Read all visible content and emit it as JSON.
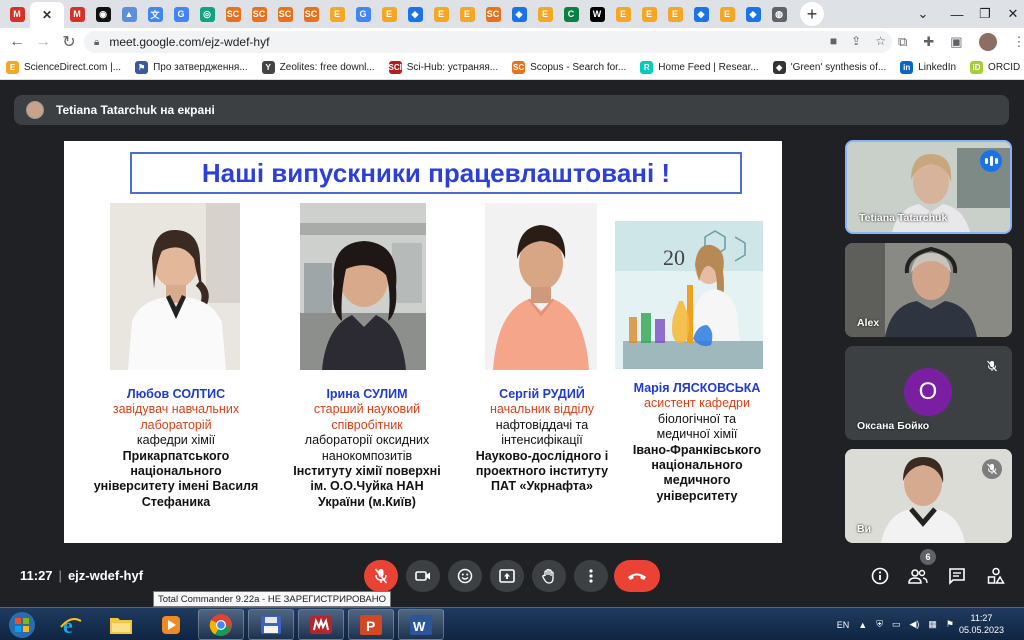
{
  "browser": {
    "tabs": [
      {
        "icon": "gmail-icon",
        "letter": "M",
        "color": "#d93025"
      },
      {
        "icon": "close-icon",
        "letter": "✕",
        "color": "#333",
        "active": true
      },
      {
        "icon": "gmail-icon",
        "letter": "M",
        "color": "#d93025"
      },
      {
        "icon": "eye-icon",
        "letter": "◉",
        "color": "#111"
      },
      {
        "icon": "chart-icon",
        "letter": "▲",
        "color": "#5b8fd8"
      },
      {
        "icon": "translate-icon",
        "letter": "文",
        "color": "#4285f4"
      },
      {
        "icon": "google-icon",
        "letter": "G",
        "color": "#4285f4"
      },
      {
        "icon": "openai-icon",
        "letter": "◎",
        "color": "#10a37f"
      },
      {
        "icon": "scopus-icon",
        "letter": "SC",
        "color": "#e9711c"
      },
      {
        "icon": "scopus-icon",
        "letter": "SC",
        "color": "#e9711c"
      },
      {
        "icon": "scopus-icon",
        "letter": "SC",
        "color": "#e9711c"
      },
      {
        "icon": "scopus-icon",
        "letter": "SC",
        "color": "#e9711c"
      },
      {
        "icon": "elsevier-icon",
        "letter": "E",
        "color": "#f5a623"
      },
      {
        "icon": "google-icon",
        "letter": "G",
        "color": "#4285f4"
      },
      {
        "icon": "elsevier-icon",
        "letter": "E",
        "color": "#f5a623"
      },
      {
        "icon": "diamond-icon",
        "letter": "◆",
        "color": "#1a73e8"
      },
      {
        "icon": "elsevier-icon",
        "letter": "E",
        "color": "#f5a623"
      },
      {
        "icon": "elsevier-icon",
        "letter": "E",
        "color": "#f5a623"
      },
      {
        "icon": "scopus-icon",
        "letter": "SC",
        "color": "#e9711c"
      },
      {
        "icon": "diamond-icon",
        "letter": "◆",
        "color": "#1a73e8"
      },
      {
        "icon": "elsevier-icon",
        "letter": "E",
        "color": "#f5a623"
      },
      {
        "icon": "c-icon",
        "letter": "C",
        "color": "#0b8043"
      },
      {
        "icon": "w-icon",
        "letter": "W",
        "color": "#000"
      },
      {
        "icon": "elsevier-icon",
        "letter": "E",
        "color": "#f5a623"
      },
      {
        "icon": "elsevier-icon",
        "letter": "E",
        "color": "#f5a623"
      },
      {
        "icon": "elsevier-icon",
        "letter": "E",
        "color": "#f5a623"
      },
      {
        "icon": "diamond-icon",
        "letter": "◆",
        "color": "#1a73e8"
      },
      {
        "icon": "elsevier-icon",
        "letter": "E",
        "color": "#f5a623"
      },
      {
        "icon": "diamond-icon",
        "letter": "◆",
        "color": "#1a73e8"
      },
      {
        "icon": "chrome-icon",
        "letter": "◍",
        "color": "#5f6368"
      }
    ],
    "url": "meet.google.com/ejz-wdef-hyf",
    "bookmarks": [
      {
        "label": "ScienceDirect.com |...",
        "letter": "E",
        "color": "#f5a623"
      },
      {
        "label": "Про затвердження...",
        "letter": "⚑",
        "color": "#3b5998"
      },
      {
        "label": "Zeolites: free downl...",
        "letter": "Y",
        "color": "#444"
      },
      {
        "label": "Sci-Hub: устраняя...",
        "letter": "SCI",
        "color": "#b71c1c"
      },
      {
        "label": "Scopus - Search for...",
        "letter": "SC",
        "color": "#e9711c"
      },
      {
        "label": "Home Feed | Resear...",
        "letter": "R",
        "color": "#00ccbb"
      },
      {
        "label": "'Green' synthesis of...",
        "letter": "◆",
        "color": "#333"
      },
      {
        "label": "LinkedIn",
        "letter": "in",
        "color": "#0a66c2"
      },
      {
        "label": "ORCID",
        "letter": "iD",
        "color": "#a6ce39"
      }
    ]
  },
  "meet": {
    "presenting_text": "Tetiana Tatarchuk на екрані",
    "slide": {
      "title": "Наші випускники працевлаштовані !",
      "people": [
        {
          "name": "Любов СОЛТИС",
          "role": "завідувач навчальних лабораторій",
          "plain": "кафедри хімії",
          "bold": "Прикарпатського національного університету імені Василя Стефаника"
        },
        {
          "name": "Ірина СУЛИМ",
          "role": "старший науковий співробітник",
          "plain": "лабораторії оксидних нанокомпозитів",
          "bold": "Інституту хімії поверхні ім. О.О.Чуйка НАН України (м.Київ)"
        },
        {
          "name": "Сергій РУДИЙ",
          "role": "начальник відділу",
          "plain": "нафтовіддачі та інтенсифікації",
          "bold": "Науково-дослідного і проектного інституту ПАТ «Укрнафта»"
        },
        {
          "name": "Марія ЛЯСКОВСЬКА",
          "role": "асистент кафедри",
          "plain": "біологічної та медичної хімії",
          "bold": "Івано-Франківського національного медичного університету"
        }
      ],
      "photo4_text": "20"
    },
    "participants": [
      {
        "name": "Tetiana Tatarchuk",
        "status": "speaking"
      },
      {
        "name": "Alex",
        "status": "none"
      },
      {
        "name": "Оксана Бойко",
        "initial": "О",
        "status": "muted",
        "avatar_color": "#7b1fa2"
      },
      {
        "name": "Ви",
        "status": "muted"
      }
    ],
    "meeting_time": "11:27",
    "meeting_code": "ejz-wdef-hyf",
    "participants_count": "6",
    "tooltip": "Total Commander 9.22a - НЕ ЗАРЕГИСТРИРОВАНО"
  },
  "taskbar": {
    "language": "EN",
    "clock_time": "11:27",
    "clock_date": "05.05.2023"
  }
}
